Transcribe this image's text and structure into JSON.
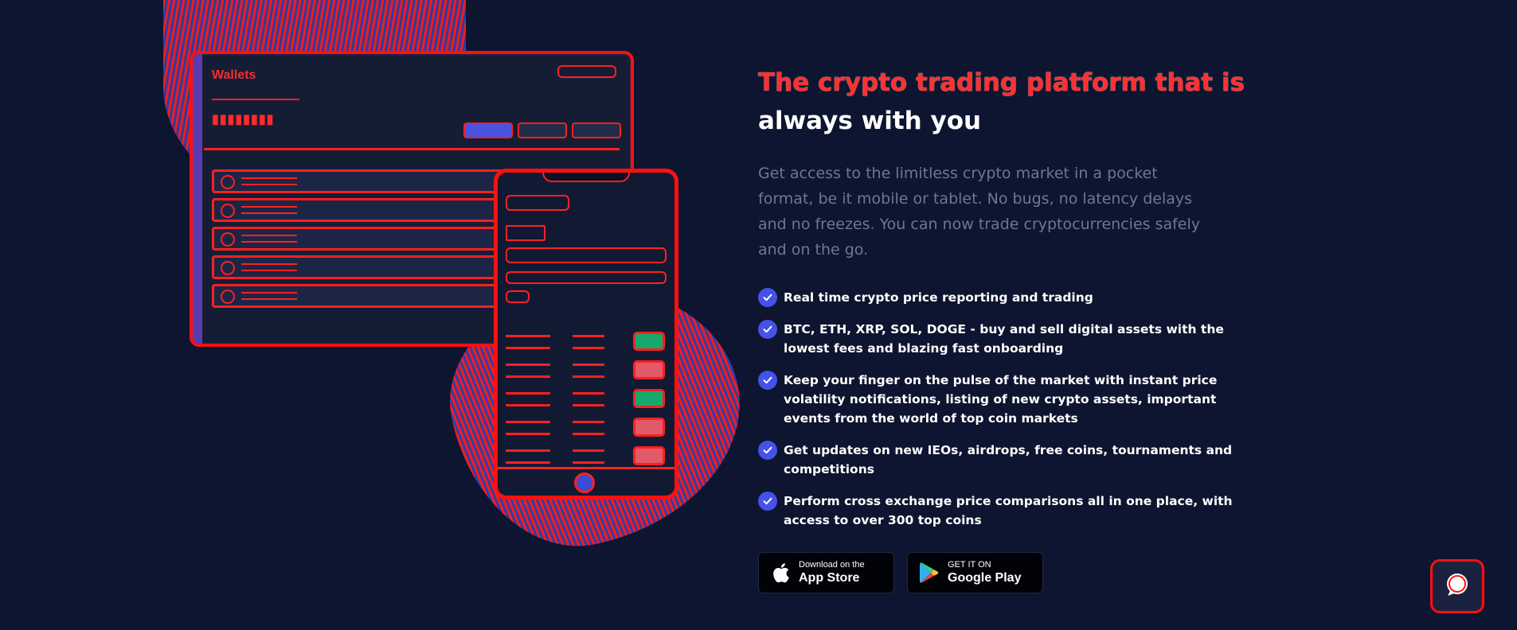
{
  "illustration": {
    "tablet": {
      "title": "Wallets"
    }
  },
  "content": {
    "headline_line1": "The crypto trading platform that is",
    "headline_line2": "always with you",
    "description": "Get access to the limitless crypto market in a pocket format, be it mobile or tablet. No bugs, no latency delays and no freezes. You can now trade cryptocurrencies safely and on the go.",
    "features": [
      "Real time crypto price reporting and trading",
      "BTC, ETH, XRP, SOL, DOGE - buy and sell digital assets with the lowest fees and blazing fast onboarding",
      "Keep your finger on the pulse of the market with instant price volatility notifications, listing of new crypto assets, important events from the world of top coin markets",
      "Get updates on new IEOs, airdrops, free coins, tournaments and competitions",
      "Perform cross exchange price comparisons all in one place, with access to over 300 top coins"
    ],
    "app_store": {
      "small": "Download on the",
      "big": "App Store"
    },
    "google_play": {
      "small": "GET IT ON",
      "big": "Google Play"
    }
  },
  "colors": {
    "background": "#0d1530",
    "accent": "#4552e8",
    "description": "#6e7793",
    "highlight": "#ff3030"
  },
  "icons": [
    "check-icon",
    "apple-icon",
    "google-play-icon",
    "chat-icon"
  ]
}
